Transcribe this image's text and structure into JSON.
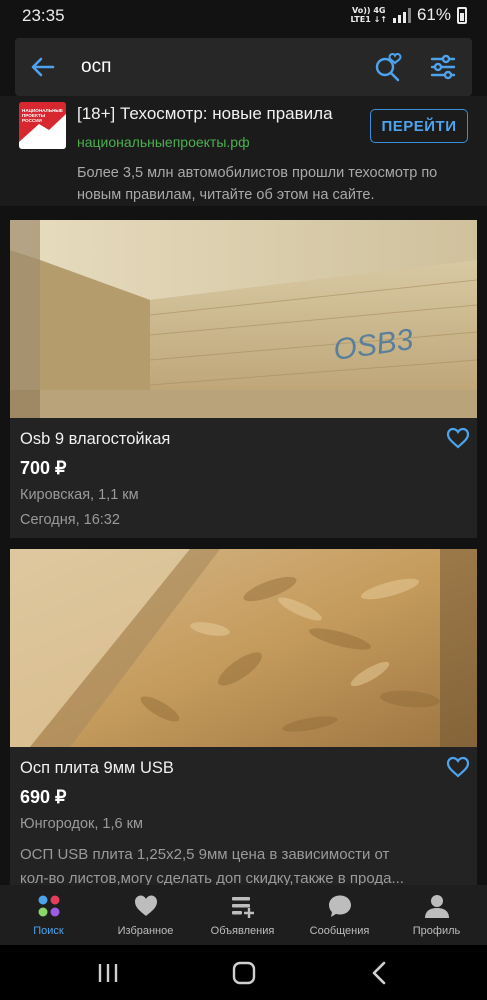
{
  "status_bar": {
    "time": "23:35",
    "net_top": "Vo)) 4G",
    "net_bottom": "LTE1 ↓↑",
    "battery": "61%"
  },
  "search": {
    "query": "осп",
    "icons": {
      "back": "arrow-left-icon",
      "save": "heart-search-icon",
      "filter": "sliders-icon"
    }
  },
  "ad": {
    "logo_text": "НАЦИОНАЛЬНЫЕ ПРОЕКТЫ РОССИИ",
    "title": "[18+] Техосмотр: новые правила",
    "domain": "национальныепроекты.рф",
    "button": "ПЕРЕЙТИ",
    "description": "Более 3,5 млн автомобилистов прошли техосмотр по новым правилам, читайте об этом на сайте."
  },
  "listings": [
    {
      "title": "Osb 9 влагостойкая",
      "price": "700 ₽",
      "location": "Кировская, 1,1 км",
      "date": "Сегодня, 16:32",
      "photo_text": "OSB3"
    },
    {
      "title": "Осп плита 9мм USB",
      "price": "690 ₽",
      "location": "Юнгородок, 1,6 км",
      "desc_line1": "ОСП USB плита 1,25х2,5  9мм цена в зависимости от",
      "desc_line2": "кол-во листов,могу сделать доп скидку,также в прода..."
    }
  ],
  "bottom_nav": [
    {
      "label": "Поиск",
      "icon": "search-dots-icon",
      "active": true
    },
    {
      "label": "Избранное",
      "icon": "heart-icon",
      "active": false
    },
    {
      "label": "Объявления",
      "icon": "list-add-icon",
      "active": false
    },
    {
      "label": "Сообщения",
      "icon": "chat-bubble-icon",
      "active": false
    },
    {
      "label": "Профиль",
      "icon": "person-icon",
      "active": false
    }
  ],
  "colors": {
    "accent": "#4ea3ec",
    "background": "#121212",
    "card": "#232323",
    "ad_domain": "#4caf50"
  }
}
